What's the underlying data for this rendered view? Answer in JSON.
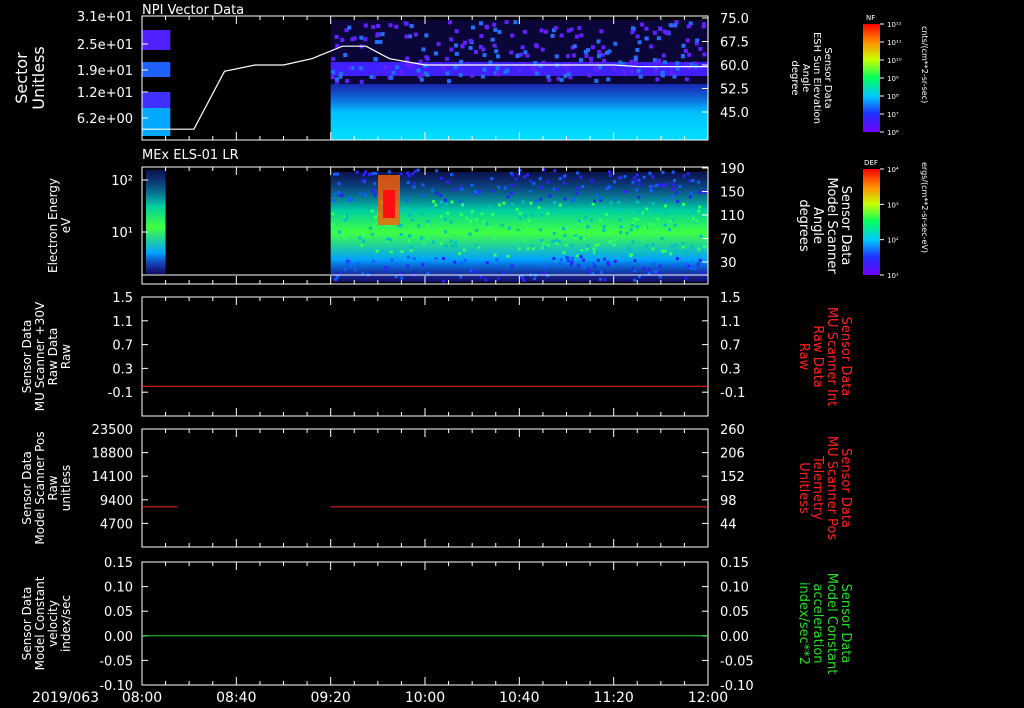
{
  "date_label": "2019/063",
  "x_ticks": [
    "08:00",
    "08:40",
    "09:20",
    "10:00",
    "10:40",
    "11:20",
    "12:00"
  ],
  "colorbars": [
    {
      "title": "NF",
      "unit": "cnts/(cm**2-sr-sec)",
      "ticks": [
        "10¹²",
        "10¹¹",
        "10¹⁰",
        "10⁹",
        "10⁸",
        "10⁷",
        "10⁶"
      ]
    },
    {
      "title": "DEF",
      "unit": "ergs/(cm**2-sr-sec-eV)",
      "ticks": [
        "10⁴",
        "10³",
        "10²",
        "10¹"
      ]
    }
  ],
  "chart_data": [
    {
      "type": "heatmap",
      "title": "NPI Vector Data",
      "ylabel": [
        "Sector",
        "Unitless"
      ],
      "yticks": [
        "3.1e+01",
        "2.5e+01",
        "1.9e+01",
        "1.2e+01",
        "6.2e+00"
      ],
      "right_ylabel": [
        "Sensor Data",
        "ESH Sun Elevation",
        "Angle",
        "degree"
      ],
      "right_yticks": [
        "75.0",
        "67.5",
        "60.0",
        "52.5",
        "45.0"
      ],
      "right_ylim": [
        37.5,
        75.0
      ],
      "overlay_line": {
        "x": [
          "08:00",
          "08:10",
          "08:22",
          "08:35",
          "08:48",
          "09:00",
          "09:12",
          "09:25",
          "09:35",
          "09:45",
          "10:00",
          "10:40",
          "11:20",
          "11:30",
          "12:00"
        ],
        "y": [
          39.5,
          39.5,
          39.5,
          58,
          60,
          60,
          62,
          66,
          66,
          62,
          60,
          60,
          60,
          59.5,
          59.5
        ]
      },
      "data_gap": [
        "08:12",
        "09:20"
      ]
    },
    {
      "type": "heatmap",
      "title": "MEx ELS-01 LR",
      "ylabel": [
        "Electron Energy",
        "eV"
      ],
      "yticks": [
        "10²",
        "10¹"
      ],
      "right_ylabel": [
        "Sensor Data",
        "Model Scanner",
        "Angle",
        "degrees"
      ],
      "right_yticks": [
        "190",
        "150",
        "110",
        "70",
        "30"
      ],
      "data_gap": [
        "08:10",
        "09:20"
      ]
    },
    {
      "type": "line",
      "ylabel": [
        "Sensor Data",
        "MU Scanner +30V",
        "Raw Data",
        "Raw"
      ],
      "yticks": [
        "1.5",
        "1.1",
        "0.7",
        "0.3",
        "-0.1"
      ],
      "ylim": [
        -0.5,
        1.5
      ],
      "right_ylabel": [
        "Sensor Data",
        "MU Scanner Int",
        "Raw Data",
        "Raw"
      ],
      "right_yticks": [
        "1.5",
        "1.1",
        "0.7",
        "0.3",
        "-0.1"
      ],
      "series": [
        {
          "color": "#ff2020",
          "x": [
            "08:00",
            "12:00"
          ],
          "y": [
            0.0,
            0.0
          ]
        }
      ]
    },
    {
      "type": "line",
      "ylabel": [
        "Sensor Data",
        "Model Scanner Pos",
        "Raw",
        "unitless"
      ],
      "yticks": [
        "23500",
        "18800",
        "14100",
        "9400",
        "4700"
      ],
      "ylim": [
        0,
        23500
      ],
      "right_ylabel": [
        "Sensor Data",
        "MU Scanner Pos",
        "Telemetry",
        "Unitless"
      ],
      "right_yticks": [
        "260",
        "206",
        "152",
        "98",
        "44"
      ],
      "series": [
        {
          "color": "#ff2020",
          "segments": [
            [
              [
                "08:00",
                8000
              ],
              [
                "08:15",
                8000
              ]
            ],
            [
              [
                "09:20",
                8000
              ],
              [
                "12:00",
                8000
              ]
            ]
          ]
        }
      ]
    },
    {
      "type": "line",
      "ylabel": [
        "Sensor Data",
        "Model Constant",
        "velocity",
        "index/sec"
      ],
      "yticks": [
        "0.15",
        "0.10",
        "0.05",
        "0.00",
        "-0.05",
        "-0.10"
      ],
      "ylim": [
        -0.1,
        0.15
      ],
      "right_ylabel": [
        "Sensor Data",
        "Model Constant",
        "acceleration",
        "index/sec**2"
      ],
      "right_yticks": [
        "0.15",
        "0.10",
        "0.05",
        "0.00",
        "-0.05",
        "-0.10"
      ],
      "series": [
        {
          "color": "#22dd22",
          "x": [
            "08:00",
            "12:00"
          ],
          "y": [
            0.0,
            0.0
          ]
        }
      ]
    }
  ],
  "colors": {
    "background": "#000000",
    "axis": "#ffffff",
    "red_label": "#ff2020",
    "green_label": "#22dd22"
  }
}
